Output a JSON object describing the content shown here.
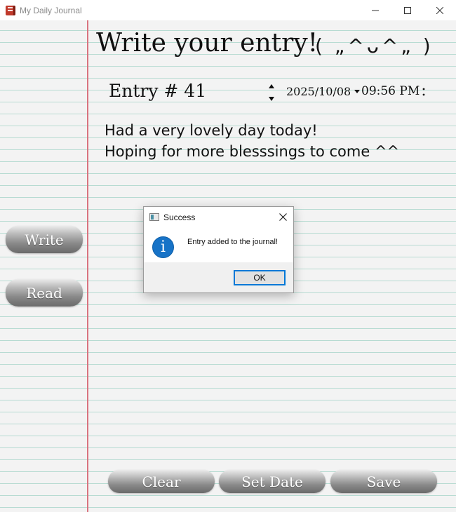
{
  "window": {
    "title": "My Daily Journal"
  },
  "heading": {
    "text": "Write your entry!",
    "kaomoji": "( „^ᴗ^„ )"
  },
  "entry": {
    "label": "Entry # 41",
    "date": "2025/10/08",
    "time": "09:56 PM",
    "text": "Had a very lovely day today!\nHoping for more blesssings to come ^^"
  },
  "sidebar": {
    "write_label": "Write",
    "read_label": "Read"
  },
  "actions": {
    "clear_label": "Clear",
    "set_date_label": "Set Date",
    "save_label": "Save"
  },
  "dialog": {
    "title": "Success",
    "message": "Entry added to the journal!",
    "ok_label": "OK",
    "icon": "info-icon"
  },
  "colors": {
    "rule_line": "#b7dbd2",
    "margin_line": "#d9737f",
    "info_blue": "#1773c7",
    "focus_blue": "#0078d7"
  }
}
